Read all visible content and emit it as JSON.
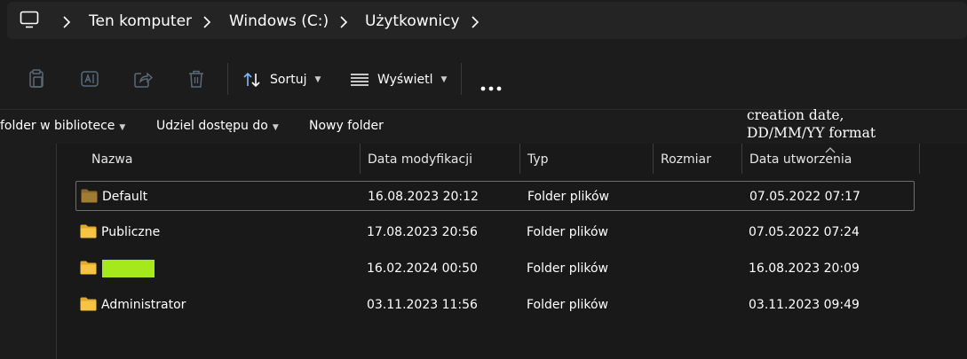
{
  "address_bar": {
    "icons": {
      "computer": "computer-icon",
      "separator": "chevron-right-icon"
    },
    "breadcrumbs": [
      "Ten komputer",
      "Windows (C:)",
      "Użytkownicy"
    ]
  },
  "toolbar": {
    "icons": [
      "copy-icon",
      "rename-icon",
      "share-icon",
      "delete-icon",
      "more-icon"
    ],
    "sort_label": "Sortuj",
    "view_label": "Wyświetl"
  },
  "command_bar": {
    "library_label": "folder w bibliotece",
    "share_label": "Udziel dostępu do",
    "new_folder_label": "Nowy folder"
  },
  "annotation": {
    "line1": "creation date,",
    "line2": "DD/MM/YY format"
  },
  "columns": {
    "name": "Nazwa",
    "modified": "Data modyfikacji",
    "type": "Typ",
    "size": "Rozmiar",
    "created": "Data utworzenia"
  },
  "files": [
    {
      "name": "Default",
      "modified": "16.08.2023 20:12",
      "type": "Folder plików",
      "size": "",
      "created": "07.05.2022 07:17",
      "selected": true,
      "redacted": false
    },
    {
      "name": "Publiczne",
      "modified": "17.08.2023 20:56",
      "type": "Folder plików",
      "size": "",
      "created": "07.05.2022 07:24",
      "selected": false,
      "redacted": false
    },
    {
      "name": "",
      "modified": "16.02.2024 00:50",
      "type": "Folder plików",
      "size": "",
      "created": "16.08.2023 20:09",
      "selected": false,
      "redacted": true
    },
    {
      "name": "Administrator",
      "modified": "03.11.2023 11:56",
      "type": "Folder plików",
      "size": "",
      "created": "03.11.2023 09:49",
      "selected": false,
      "redacted": false
    }
  ],
  "colors": {
    "background": "#191919",
    "folder_yellow": "#f6c343",
    "folder_dim": "#8a6a2a",
    "redaction": "#a5e81c",
    "sort_icon": "#7fb6ff"
  }
}
